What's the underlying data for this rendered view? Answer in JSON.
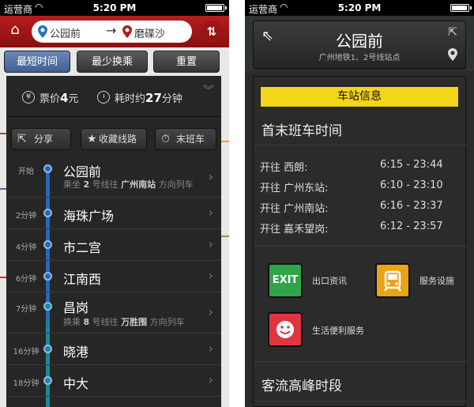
{
  "status_bar": {
    "carrier": "运营商",
    "time": "5:20 PM"
  },
  "left": {
    "route_from": "公园前",
    "route_to": "磨碟沙",
    "arrow": "→",
    "tabs": [
      "最短时间",
      "最少换乘",
      "重置"
    ],
    "fare_label": "票价",
    "fare_value": "4",
    "fare_unit": "元",
    "duration_label": "耗时约",
    "duration_value": "27",
    "duration_unit": "分钟",
    "actions": {
      "share": "分享",
      "favorite": "收藏线路",
      "last_train": "末班车"
    },
    "stations": [
      {
        "time": "开始",
        "name": "公园前",
        "sub1": "乘坐",
        "line": "2",
        "sub2": "号线往",
        "dir": "广州南站",
        "sub3": "方向列车"
      },
      {
        "time": "2分钟",
        "name": "海珠广场"
      },
      {
        "time": "4分钟",
        "name": "市二宫"
      },
      {
        "time": "6分钟",
        "name": "江南西"
      },
      {
        "time": "7分钟",
        "name": "昌岗",
        "sub1": "换乘",
        "line": "8",
        "sub2": "号线往",
        "dir": "万胜围",
        "sub3": "方向列车"
      },
      {
        "time": "16分钟",
        "name": "晓港"
      },
      {
        "time": "18分钟",
        "name": "中大"
      }
    ],
    "colors": {
      "topbar": "#a31717",
      "line2": "#2568b8",
      "line8": "#1a8a9a"
    }
  },
  "right": {
    "station_name": "公园前",
    "station_lines": "广州地铁1、2号线站点",
    "info_tab": "车站信息",
    "schedule_title": "首末班车时间",
    "schedule": [
      {
        "label": "开往 西朗:",
        "time": "6:15 - 23:44"
      },
      {
        "label": "开往 广州东站:",
        "time": "6:10 - 23:10"
      },
      {
        "label": "开往 广州南站:",
        "time": "6:16 - 23:37"
      },
      {
        "label": "开往 嘉禾望岗:",
        "time": "6:12 - 23:57"
      }
    ],
    "services": {
      "exit_icon": "EXIT",
      "exit": "出口资讯",
      "facility": "服务设施",
      "life": "生活便利服务"
    },
    "peak_title": "客流高峰时段",
    "colors": {
      "ribbon": "#f3d51a",
      "exit": "#31a34b",
      "facility": "#e8a317",
      "life": "#e0353f"
    }
  }
}
